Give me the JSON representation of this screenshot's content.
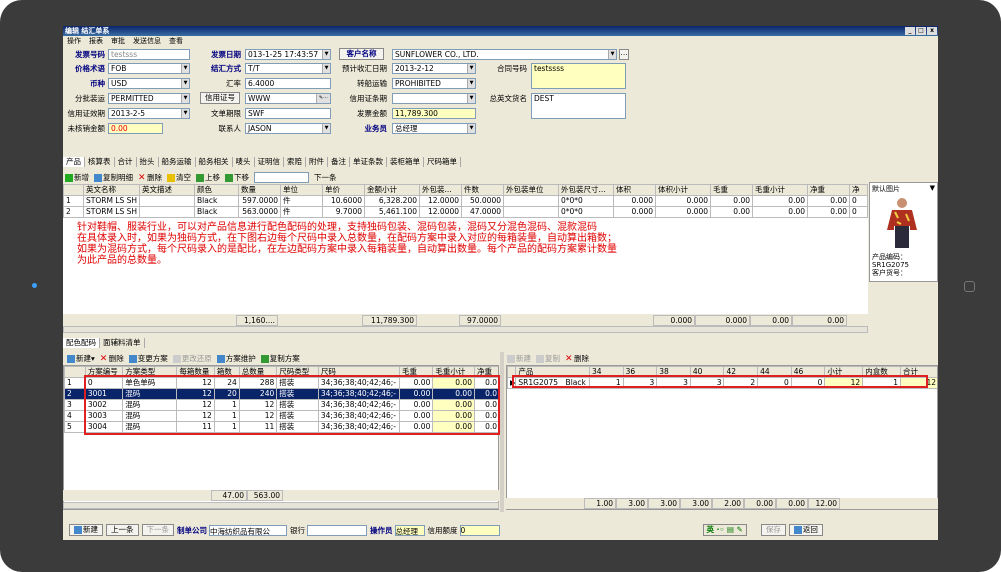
{
  "app": {
    "title": "编辑 结汇单系",
    "menu": [
      "操作",
      "报表",
      "审批",
      "发送信息",
      "查看"
    ]
  },
  "form": {
    "invoice_no_label": "发票号码",
    "invoice_no": "testsss",
    "price_terms_label": "价格术语",
    "price_terms": "FOB",
    "currency_label": "币种",
    "currency": "USD",
    "partial_label": "分批装运",
    "partial": "PERMITTED",
    "lc_valid_label": "信用证效期",
    "lc_valid": "2013-2-5",
    "lc_amount_label": "未核销金额",
    "lc_amount": "0.00",
    "invoice_date_label": "发票日期",
    "invoice_date": "013-1-25 17:43:57",
    "settle_label": "结汇方式",
    "settle": "T/T",
    "rate_label": "汇率",
    "rate": "6.4000",
    "lc_btn": "信用证号",
    "lc_no": "WWW",
    "doc_term_label": "文单期限",
    "doc_term": "SWF",
    "contact_label": "联系人",
    "contact": "JASON",
    "customer_btn": "客户名称",
    "customer": "SUNFLOWER CO., LTD.",
    "expect_date_label": "预计收汇日期",
    "expect_date": "2013-2-12",
    "transship_label": "转船运输",
    "transship": "PROHIBITED",
    "lc_terms_label": "信用证条期",
    "lc_terms": "",
    "inv_amount_label": "发票金额",
    "inv_amount": "11,789.300",
    "salesman_label": "业务员",
    "salesman": "总经理",
    "contract_label": "合同号码",
    "contract": "testssss",
    "dest_label": "总英文货名",
    "dest": "DEST"
  },
  "tabs": [
    "产品",
    "核算表",
    "合计",
    "抬头",
    "船务运输",
    "船务相关",
    "唛头",
    "证明信",
    "索赔",
    "附件",
    "备注",
    "单证条款",
    "装柜箱单",
    "尺码箱单"
  ],
  "toolbar1": [
    "新增",
    "复制明细",
    "删除",
    "清空",
    "上移",
    "下移",
    "下一条"
  ],
  "product_grid": {
    "headers": [
      "",
      "英文名称",
      "英文描述",
      "颜色",
      "数量",
      "单位",
      "单价",
      "金额小计",
      "外包装...",
      "件数",
      "外包装单位",
      "外包装尺寸...",
      "体积",
      "体积小计",
      "毛重",
      "毛重小计",
      "净重",
      "净"
    ],
    "rows": [
      [
        "1",
        "STORM LS SH",
        "",
        "Black",
        "597.0000",
        "件",
        "10.6000",
        "6,328.200",
        "12.0000",
        "50.0000",
        "",
        "0*0*0",
        "0.000",
        "0.000",
        "0.00",
        "0.00",
        "0.00",
        "0"
      ],
      [
        "2",
        "STORM LS SH",
        "",
        "Black",
        "563.0000",
        "件",
        "9.7000",
        "5,461.100",
        "12.0000",
        "47.0000",
        "",
        "0*0*0",
        "0.000",
        "0.000",
        "0.00",
        "0.00",
        "0.00",
        "0"
      ]
    ],
    "sum": [
      "1,160....",
      "11,789.300",
      "97.0000",
      "0.000",
      "0.000",
      "0.00",
      "0.00"
    ]
  },
  "annotation": "针对鞋帽、服装行业，可以对产品信息进行配色配码的处理，支持独码包装、混码包装，混码又分混色混码、混款混码\n在具体录入时，如果为独码方式，在下图右边每个尺码中录入总数量，在配码方案中录入对应的每箱装量，自动算出箱数；\n如果为混码方式，每个尺码录入的是配比，在左边配码方案中录入每箱装量，自动算出数量。每个产品的配码方案累计数量\n为此产品的总数量。",
  "side": {
    "image_label": "默认图片",
    "product_code_label": "产品编码：",
    "product_code": "SR1G2075",
    "customer_no_label": "客户货号："
  },
  "lower_tabs": [
    "配色配码",
    "面辅料清单"
  ],
  "toolbar2": [
    "新建",
    "删除",
    "变更方案",
    "更改还原",
    "方案维护",
    "复制方案"
  ],
  "scheme_grid": {
    "headers": [
      "",
      "方案编号",
      "方案类型",
      "每箱数量",
      "箱数",
      "总数量",
      "尺码类型",
      "尺码",
      "毛重",
      "毛重小计",
      "净重"
    ],
    "rows": [
      [
        "1",
        "0",
        "单色单码",
        "12",
        "24",
        "288",
        "搭装",
        "34;36;38;40;42;46;-",
        "0.00",
        "0.00",
        "0.0"
      ],
      [
        "2",
        "3001",
        "混码",
        "12",
        "20",
        "240",
        "搭装",
        "34;36;38;40;42;46;-",
        "0.00",
        "0.00",
        "0.0"
      ],
      [
        "3",
        "3002",
        "混码",
        "12",
        "1",
        "12",
        "搭装",
        "34;36;38;40;42;46;-",
        "0.00",
        "0.00",
        "0.0"
      ],
      [
        "4",
        "3003",
        "混码",
        "12",
        "1",
        "12",
        "搭装",
        "34;36;38;40;42;46;-",
        "0.00",
        "0.00",
        "0.0"
      ],
      [
        "5",
        "3004",
        "混码",
        "11",
        "1",
        "11",
        "搭装",
        "34;36;38;40;42;46;-",
        "0.00",
        "0.00",
        "0.0"
      ]
    ],
    "sum": [
      "47.00",
      "563.00"
    ]
  },
  "toolbar3": [
    "新建",
    "复制",
    "删除"
  ],
  "size_grid": {
    "headers": [
      "产品",
      "34",
      "36",
      "38",
      "40",
      "42",
      "44",
      "46",
      "小计",
      "内盒数",
      "合计"
    ],
    "row": [
      "SR1G2075__Black",
      "1",
      "3",
      "3",
      "3",
      "2",
      "0",
      "0",
      "12",
      "1",
      "12"
    ],
    "sum": [
      "1.00",
      "3.00",
      "3.00",
      "3.00",
      "2.00",
      "0.00",
      "0.00",
      "12.00"
    ]
  },
  "statusbar": {
    "new": "新建",
    "prev": "上一条",
    "next": "下一条",
    "company_label": "制单公司",
    "company": "中海纺织品有限公",
    "bank_label": "银行",
    "bank": "",
    "operator_label": "操作员",
    "operator": "总经理",
    "credit_label": "信用额度",
    "credit": "0",
    "ime": "英",
    "save": "保存",
    "back": "返回"
  }
}
